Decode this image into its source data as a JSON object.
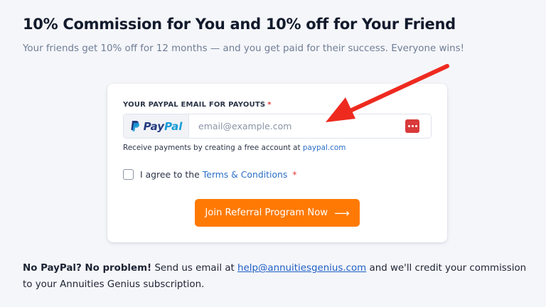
{
  "header": {
    "title": "10% Commission for You and 10% off for Your Friend",
    "subtitle": "Your friends get 10% off for 12 months — and you get paid for their success. Everyone wins!"
  },
  "form": {
    "field_label": "YOUR PAYPAL EMAIL FOR PAYOUTS",
    "required_mark": "*",
    "paypal_brand_pay": "Pay",
    "paypal_brand_pal": "Pal",
    "email_placeholder": "email@example.com",
    "email_value": "",
    "help_text": "Receive payments by creating a free account at",
    "help_link": "paypal.com",
    "agree_prefix": "I agree to the",
    "agree_link": "Terms & Conditions",
    "agree_required": "*",
    "agree_checked": false,
    "submit_label": "Join Referral Program Now",
    "submit_arrow": "⟶"
  },
  "footer": {
    "bold_text": "No PayPal? No problem!",
    "text_before_link": "Send us email at",
    "email_link": "help@annuitiesgenius.com",
    "text_after_link": "and we'll credit your commission to your Annuities Genius subscription."
  },
  "colors": {
    "accent": "#ff7a05",
    "link": "#2c6fc8",
    "annotation_arrow": "#ee2a1f",
    "required": "#e53935",
    "background": "#f5f6fa"
  },
  "icons": {
    "paypal_logo": "paypal-logo-icon",
    "password_manager": "password-manager-icon",
    "annotation": "red-annotation-arrow-icon"
  }
}
